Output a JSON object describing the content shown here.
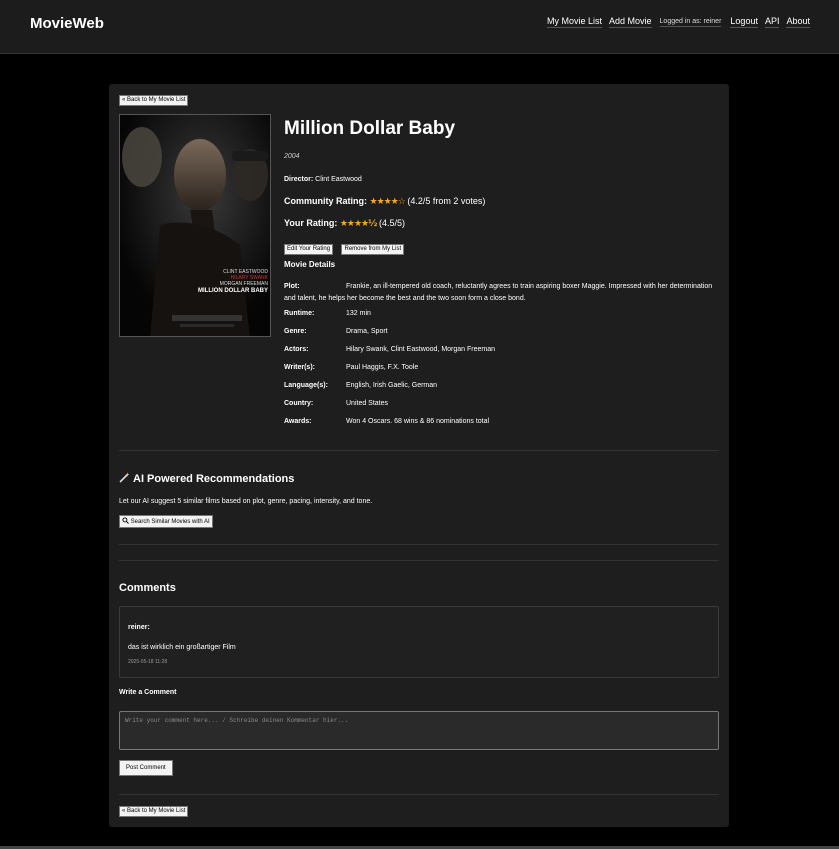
{
  "header": {
    "brand": "MovieWeb",
    "nav": {
      "my_list": "My Movie List",
      "add_movie": "Add Movie",
      "logged_in": "Logged in as: reiner",
      "logout": "Logout",
      "api": "API",
      "about": "About"
    }
  },
  "back_label": "« Back to My Movie List",
  "movie": {
    "title": "Million Dollar Baby",
    "year": "2004",
    "director_label": "Director:",
    "director": "Clint Eastwood",
    "poster": {
      "credits": [
        "CLINT EASTWOOD",
        "HILARY SWANK",
        "MORGAN FREEMAN"
      ],
      "title": "MILLION DOLLAR BABY"
    }
  },
  "community_rating": {
    "label": "Community Rating:",
    "stars": "★★★★☆",
    "text": "(4.2/5 from 2 votes)",
    "value": 4.2
  },
  "your_rating": {
    "label": "Your Rating:",
    "stars": "★★★★½",
    "text": "(4.5/5)",
    "value": 4.5
  },
  "buttons": {
    "edit_rating": "Edit Your Rating",
    "remove": "Remove from My List"
  },
  "details": {
    "heading": "Movie Details",
    "plot_label": "Plot:",
    "plot": "Frankie, an ill-tempered old coach, reluctantly agrees to train aspiring boxer Maggie. Impressed with her determination and talent, he helps her become the best and the two soon form a close bond.",
    "runtime_label": "Runtime:",
    "runtime": "132 min",
    "genre_label": "Genre:",
    "genre": "Drama, Sport",
    "actors_label": "Actors:",
    "actors": "Hilary Swank, Clint Eastwood, Morgan Freeman",
    "writers_label": "Writer(s):",
    "writers": "Paul Haggis, F.X. Toole",
    "language_label": "Language(s):",
    "language": "English, Irish Gaelic, German",
    "country_label": "Country:",
    "country": "United States",
    "awards_label": "Awards:",
    "awards": "Won 4 Oscars. 68 wins & 86 nominations total"
  },
  "ai": {
    "title": "AI Powered Recommendations",
    "description": "Let our AI suggest 5 similar films based on plot, genre, pacing, intensity, and tone.",
    "button": "Search Similar Movies with AI"
  },
  "comments": {
    "heading": "Comments",
    "items": [
      {
        "author": "reiner:",
        "text": "das ist wirklich ein großartiger Film",
        "time": "2025-05-18 11:28"
      }
    ],
    "write_heading": "Write a Comment",
    "placeholder": "Write your comment here... / Schreibe deinen Kommentar hier...",
    "post_button": "Post Comment"
  },
  "colors": {
    "star": "#f5a623",
    "background": "#000000",
    "card": "#1e1e1e"
  }
}
